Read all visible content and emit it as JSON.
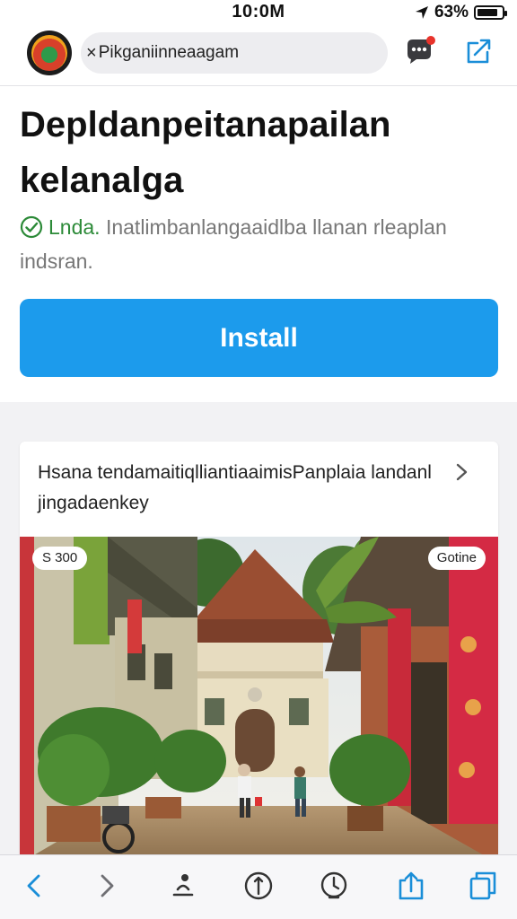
{
  "status_bar": {
    "time": "10:0M",
    "battery": "63%"
  },
  "address_bar": {
    "url_text": "Pikganiinneaagam",
    "close_glyph": "×",
    "icons": [
      "site-logo",
      "chat-notification-icon",
      "edit-share-icon"
    ]
  },
  "header": {
    "title": "Depldanpeitanapailan kelanalga",
    "verified_word": "Lnda.",
    "verified_text": "Inatlimbanlangaaidlba llanan rleaplan indsran.",
    "install_label": "Install"
  },
  "card": {
    "heading": "Hsana tendamaitiqlliantiaaimisPanplaia landanl jingadaenkey",
    "price_badge": "S 300",
    "info_badge": "Gotine"
  },
  "toolbar": {
    "icons": [
      "back-icon",
      "forward-icon",
      "person-icon",
      "compass-icon",
      "history-icon",
      "share-icon",
      "tabs-icon"
    ]
  },
  "colors": {
    "accent": "#1c9bec",
    "verified": "#2c8a38",
    "toolbar_icon": "#1a8ed8"
  }
}
